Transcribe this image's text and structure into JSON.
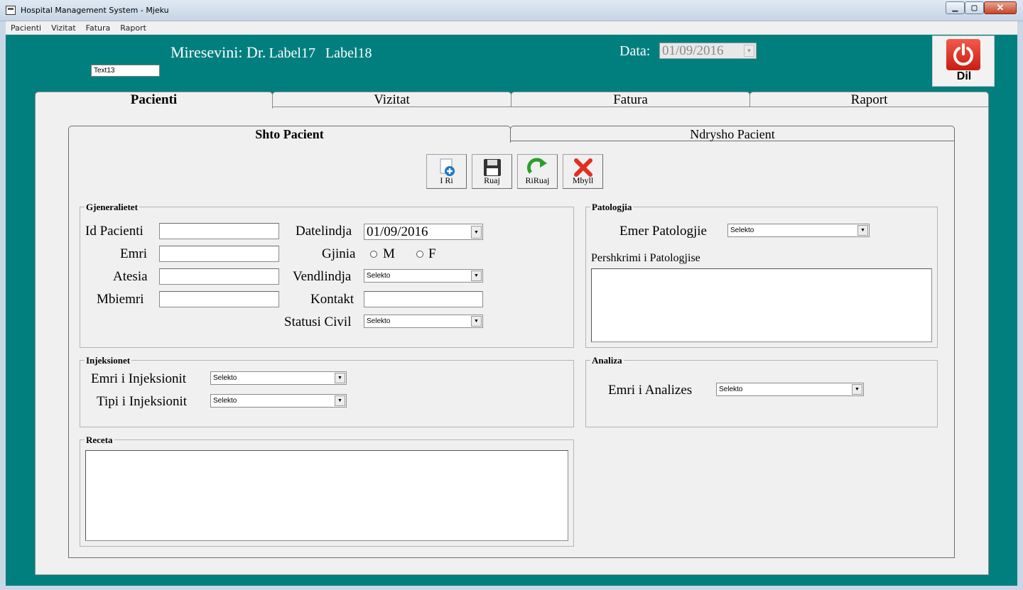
{
  "window": {
    "title": "Hospital Management System - Mjeku",
    "minimize": "▁",
    "maximize": "▢",
    "close": "✕"
  },
  "menu": [
    "Pacienti",
    "Vizitat",
    "Fatura",
    "Raport"
  ],
  "header": {
    "welcome": "Miresevini: Dr.",
    "label17": "Label17",
    "label18": "Label18",
    "text13": "Text13",
    "data_label": "Data:",
    "data_value": "01/09/2016",
    "logout_label": "Dil"
  },
  "outer_tabs": [
    "Pacienti",
    "Vizitat",
    "Fatura",
    "Raport"
  ],
  "inner_tabs": [
    "Shto Pacient",
    "Ndrysho Pacient"
  ],
  "toolbar": {
    "new": "I Ri",
    "save": "Ruaj",
    "resave": "RiRuaj",
    "close": "Mbyll"
  },
  "gjeneralitetet": {
    "title": "Gjeneralietet",
    "id_label": "Id Pacienti",
    "emri_label": "Emri",
    "atesia_label": "Atesia",
    "mbiemri_label": "Mbiemri",
    "datelindja_label": "Datelindja",
    "datelindja_value": "01/09/2016",
    "gjinia_label": "Gjinia",
    "gjinia_m": "M",
    "gjinia_f": "F",
    "vendlindja_label": "Vendlindja",
    "vendlindja_value": "Selekto",
    "kontakt_label": "Kontakt",
    "statusi_label": "Statusi Civil",
    "statusi_value": "Selekto"
  },
  "patologjia": {
    "title": "Patologjia",
    "emer_label": "Emer Patologjie",
    "emer_value": "Selekto",
    "pershkrimi_label": "Pershkrimi i Patologjise"
  },
  "injeksionet": {
    "title": "Injeksionet",
    "emri_label": "Emri i Injeksionit",
    "emri_value": "Selekto",
    "tipi_label": "Tipi i Injeksionit",
    "tipi_value": "Selekto"
  },
  "analiza": {
    "title": "Analiza",
    "emri_label": "Emri i Analizes",
    "emri_value": "Selekto"
  },
  "receta": {
    "title": "Receta"
  },
  "colors": {
    "background": "#017f7f",
    "panel": "#f0f0f0",
    "logout_red": "#d9261a"
  },
  "icons": {
    "new": "add-document-icon",
    "save": "floppy-disk-icon",
    "resave": "refresh-arrow-icon",
    "close": "red-x-icon",
    "logout": "power-icon"
  }
}
